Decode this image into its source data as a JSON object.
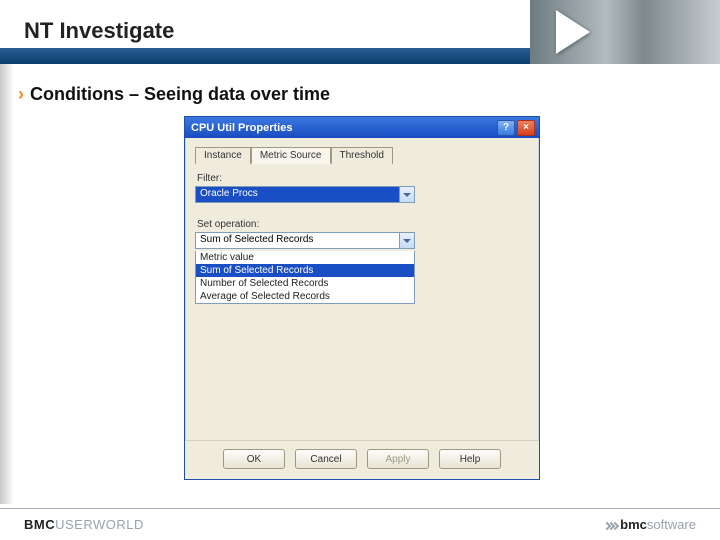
{
  "header": {
    "title": "NT Investigate"
  },
  "subtitle": {
    "chevron": "›",
    "text": "Conditions – Seeing data over time"
  },
  "dialog": {
    "title": "CPU Util Properties",
    "help_btn": "?",
    "close_btn": "×",
    "tabs": [
      "Instance",
      "Metric Source",
      "Threshold"
    ],
    "active_tab": 1,
    "filter_label": "Filter:",
    "filter_value": "Oracle Procs",
    "setop_label": "Set operation:",
    "setop_value": "Sum of Selected Records",
    "setop_options": [
      "Metric value",
      "Sum of Selected Records",
      "Number of Selected Records",
      "Average of Selected Records"
    ],
    "setop_selected_index": 1,
    "buttons": {
      "ok": "OK",
      "cancel": "Cancel",
      "apply": "Apply",
      "help": "Help"
    }
  },
  "footer": {
    "left_bold": "BMC",
    "left_light": "USERWORLD",
    "right_bold": "bmc",
    "right_light": "software"
  }
}
